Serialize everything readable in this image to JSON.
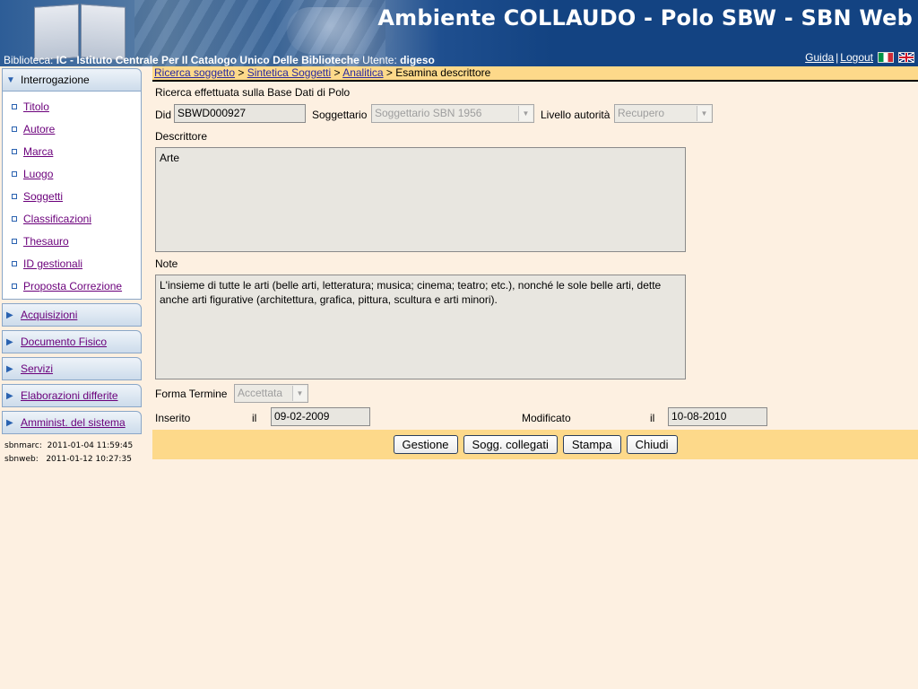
{
  "header": {
    "app_title": "Ambiente COLLAUDO - Polo SBW - SBN Web",
    "biblioteca_label": "Biblioteca:",
    "biblioteca_value": "IC - Istituto Centrale Per Il Catalogo Unico Delle Biblioteche",
    "utente_label": "Utente:",
    "utente_value": "digeso",
    "guida": "Guida",
    "separator": "|",
    "logout": "Logout"
  },
  "sidebar": {
    "interrogazione": "Interrogazione",
    "items": [
      {
        "label": "Titolo"
      },
      {
        "label": "Autore"
      },
      {
        "label": "Marca"
      },
      {
        "label": "Luogo"
      },
      {
        "label": "Soggetti"
      },
      {
        "label": "Classificazioni"
      },
      {
        "label": "Thesauro"
      },
      {
        "label": "ID gestionali"
      },
      {
        "label": "Proposta Correzione"
      }
    ],
    "sections": [
      {
        "label": "Acquisizioni"
      },
      {
        "label": "Documento Fisico"
      },
      {
        "label": "Servizi"
      },
      {
        "label": "Elaborazioni differite"
      },
      {
        "label": "Amminist. del sistema"
      }
    ],
    "stamp1": "sbnmarc:  2011-01-04 11:59:45",
    "stamp2": "sbnweb:   2011-01-12 10:27:35"
  },
  "breadcrumb": {
    "items": [
      "Ricerca soggetto",
      "Sintetica Soggetti",
      "Analitica"
    ],
    "sep": ">",
    "current": "Esamina descrittore"
  },
  "form": {
    "ricerca_info": "Ricerca effettuata sulla Base Dati di Polo",
    "did_label": "Did",
    "did_value": "SBWD000927",
    "soggettario_label": "Soggettario",
    "soggettario_value": "Soggettario SBN 1956",
    "livello_label": "Livello autorità",
    "livello_value": "Recupero",
    "descrittore_label": "Descrittore",
    "descrittore_value": "Arte",
    "note_label": "Note",
    "note_value": "L'insieme di tutte le arti (belle arti, letteratura; musica; cinema; teatro; etc.), nonché le sole belle arti, dette anche arti figurative (architettura, grafica, pittura, scultura e arti minori).",
    "forma_label": "Forma Termine",
    "forma_value": "Accettata",
    "inserito_label": "Inserito",
    "inserito_il": "il",
    "inserito_value": "09-02-2009",
    "modificato_label": "Modificato",
    "modificato_il": "il",
    "modificato_value": "10-08-2010"
  },
  "buttons": {
    "gestione": "Gestione",
    "sogg_collegati": "Sogg. collegati",
    "stampa": "Stampa",
    "chiudi": "Chiudi"
  },
  "icons": {
    "open_triangle": "▼",
    "closed_triangle": "▶",
    "dropdown_arrow": "▼"
  }
}
